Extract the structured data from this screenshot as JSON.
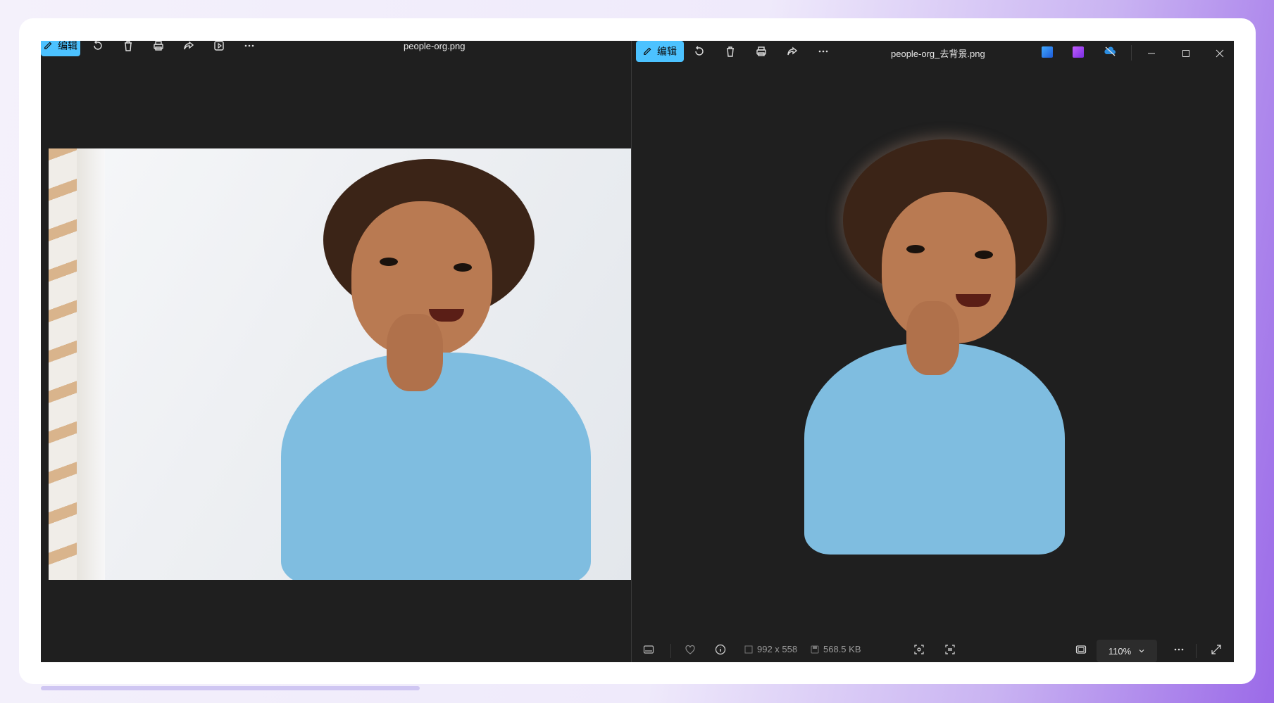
{
  "left_window": {
    "edit_label": "编辑",
    "filename": "people-org.png"
  },
  "right_window": {
    "edit_label": "编辑",
    "filename": "people-org_去背景.png",
    "status": {
      "dimensions": "992 x 558",
      "file_size": "568.5 KB",
      "zoom": "110%"
    }
  },
  "colors": {
    "accent": "#4cc2ff",
    "window_bg": "#1f1f1f",
    "shirt": "#7fbde0"
  },
  "icons": [
    "edit-icon",
    "rotate-icon",
    "delete-icon",
    "print-icon",
    "share-icon",
    "slideshow-icon",
    "more-icon",
    "app-clipchamp-icon",
    "app-paint-icon",
    "onedrive-icon",
    "minimize-icon",
    "maximize-icon",
    "close-icon",
    "filmstrip-icon",
    "heart-icon",
    "info-icon",
    "fit-icon",
    "chevron-down-icon",
    "expand-icon"
  ]
}
